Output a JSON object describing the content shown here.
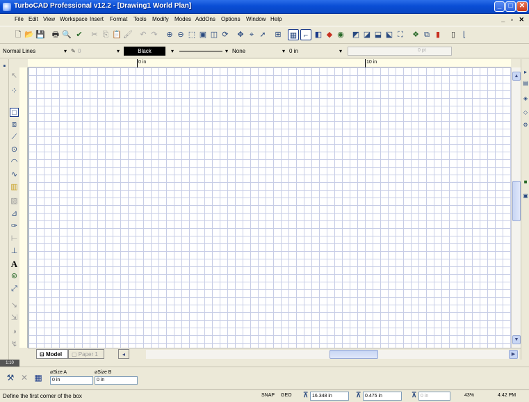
{
  "window": {
    "title": "TurboCAD Professional v12.2 - [Drawing1 World Plan]",
    "min": "_",
    "max": "□",
    "close": "✕"
  },
  "menu": {
    "items": [
      "File",
      "Edit",
      "View",
      "Workspace",
      "Insert",
      "Format",
      "Tools",
      "Modify",
      "Modes",
      "AddOns",
      "Options",
      "Window",
      "Help"
    ],
    "mdi_controls": "_ ▫ ✕"
  },
  "propbar": {
    "line_style": "Normal Lines",
    "pen_width": "0",
    "color": "Black",
    "fill": "None",
    "thickness": "0 in",
    "disabled_value": "0 pt"
  },
  "ruler": {
    "top_labels": [
      "0 in",
      "10 in"
    ]
  },
  "tabs": {
    "model": "Model",
    "paper": "Paper 1"
  },
  "inspector": {
    "size_a_label": "Size A",
    "size_a_value": "0 in",
    "size_b_label": "Size B",
    "size_b_value": "0 in"
  },
  "status": {
    "message": "Define the first corner of the box",
    "snap": "SNAP",
    "geo": "GEO",
    "x": "16.348 in",
    "y": "0.475 in",
    "z": "0 in",
    "zoom": "43%",
    "time": "4:42 PM"
  },
  "scale_label": "1:10",
  "colors": {
    "titlebar": "#0a4ed6",
    "grid": "#c7cde6",
    "canvas": "#ffffff",
    "chrome": "#ece9d8"
  }
}
